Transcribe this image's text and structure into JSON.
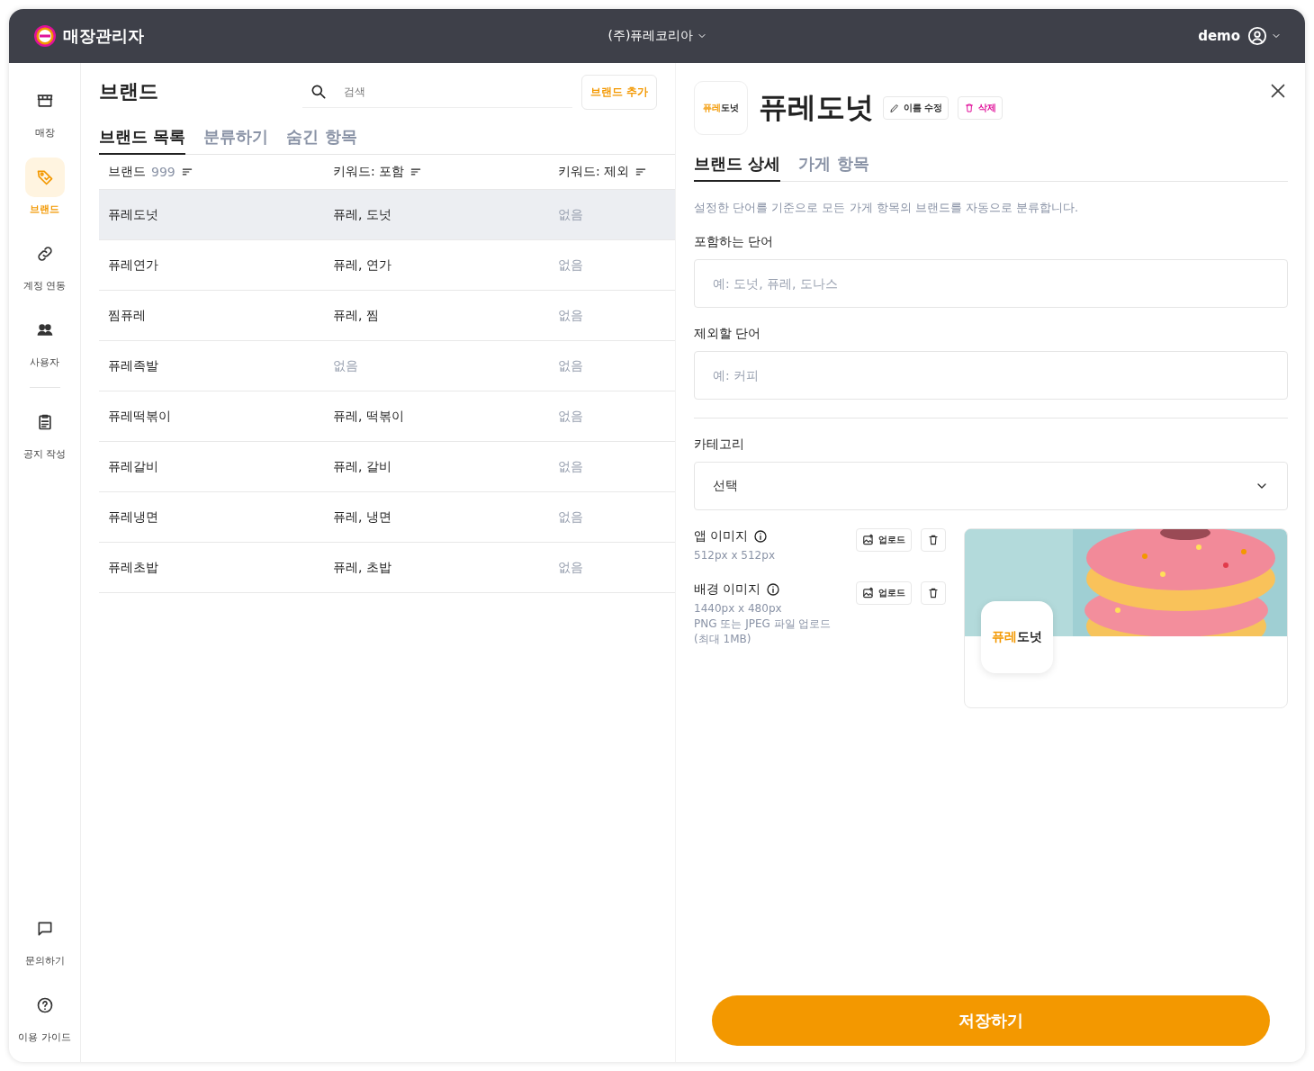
{
  "header": {
    "app_title": "매장관리자",
    "company": "(주)퓨레코리아",
    "user": "demo"
  },
  "sidebar": {
    "items": [
      {
        "label": "매장",
        "selected": false
      },
      {
        "label": "브랜드",
        "selected": true
      },
      {
        "label": "계정 연동",
        "selected": false
      },
      {
        "label": "사용자",
        "selected": false
      },
      {
        "label": "공지 작성",
        "selected": false
      }
    ],
    "bottom_items": [
      {
        "label": "문의하기"
      },
      {
        "label": "이용 가이드"
      }
    ]
  },
  "list": {
    "title": "브랜드",
    "search": {
      "placeholder": "검색"
    },
    "add_button": "브랜드 추가",
    "tabs": [
      {
        "label": "브랜드 목록",
        "selected": true
      },
      {
        "label": "분류하기",
        "selected": false
      },
      {
        "label": "숨긴 항목",
        "selected": false
      }
    ],
    "columns": [
      {
        "label": "브랜드",
        "count": "999"
      },
      {
        "label": "키워드: 포함"
      },
      {
        "label": "키워드: 제외"
      }
    ],
    "rows": [
      {
        "selected": true,
        "cells": [
          {
            "text": "퓨레도넛",
            "empty": false
          },
          {
            "text": "퓨레, 도넛",
            "empty": false
          },
          {
            "text": "없음",
            "empty": true
          }
        ]
      },
      {
        "selected": false,
        "cells": [
          {
            "text": "퓨레연가",
            "empty": false
          },
          {
            "text": "퓨레, 연가",
            "empty": false
          },
          {
            "text": "없음",
            "empty": true
          }
        ]
      },
      {
        "selected": false,
        "cells": [
          {
            "text": "찜퓨레",
            "empty": false
          },
          {
            "text": "퓨레, 찜",
            "empty": false
          },
          {
            "text": "없음",
            "empty": true
          }
        ]
      },
      {
        "selected": false,
        "cells": [
          {
            "text": "퓨레족발",
            "empty": false
          },
          {
            "text": "없음",
            "empty": true
          },
          {
            "text": "없음",
            "empty": true
          }
        ]
      },
      {
        "selected": false,
        "cells": [
          {
            "text": "퓨레떡볶이",
            "empty": false
          },
          {
            "text": "퓨레, 떡볶이",
            "empty": false
          },
          {
            "text": "없음",
            "empty": true
          }
        ]
      },
      {
        "selected": false,
        "cells": [
          {
            "text": "퓨레갈비",
            "empty": false
          },
          {
            "text": "퓨레, 갈비",
            "empty": false
          },
          {
            "text": "없음",
            "empty": true
          }
        ]
      },
      {
        "selected": false,
        "cells": [
          {
            "text": "퓨레냉면",
            "empty": false
          },
          {
            "text": "퓨레, 냉면",
            "empty": false
          },
          {
            "text": "없음",
            "empty": true
          }
        ]
      },
      {
        "selected": false,
        "cells": [
          {
            "text": "퓨레초밥",
            "empty": false
          },
          {
            "text": "퓨레, 초밥",
            "empty": false
          },
          {
            "text": "없음",
            "empty": true
          }
        ]
      }
    ]
  },
  "detail": {
    "logo": {
      "accent": "퓨레",
      "rest": "도넛"
    },
    "name": "퓨레도넛",
    "rename_button": "이름 수정",
    "delete_button": "삭제",
    "tabs": [
      {
        "label": "브랜드 상세",
        "selected": true
      },
      {
        "label": "가게 항목",
        "selected": false
      }
    ],
    "description": "설정한 단어를 기준으로 모든 가게 항목의 브랜드를 자동으로 분류합니다.",
    "include": {
      "label": "포함하는 단어",
      "placeholder": "예: 도넛, 퓨레, 도나스"
    },
    "exclude": {
      "label": "제외할 단어",
      "placeholder": "예: 커피"
    },
    "category": {
      "label": "카테고리",
      "value": "선택"
    },
    "images": [
      {
        "label": "앱 이미지",
        "notes": [
          "512px x 512px"
        ],
        "upload": "업로드"
      },
      {
        "label": "배경 이미지",
        "notes": [
          "1440px x 480px",
          "PNG 또는 JPEG 파일 업로드",
          "(최대 1MB)"
        ],
        "upload": "업로드"
      }
    ],
    "preview": {
      "kind": "picture",
      "logo": {
        "accent": "퓨레",
        "rest": "도넛"
      }
    },
    "save_button": "저장하기"
  }
}
